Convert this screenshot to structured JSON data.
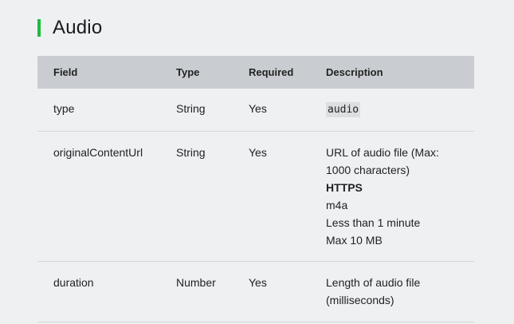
{
  "section": {
    "title": "Audio"
  },
  "table": {
    "headers": {
      "field": "Field",
      "type": "Type",
      "required": "Required",
      "description": "Description"
    },
    "rows": [
      {
        "field": "type",
        "type": "String",
        "required": "Yes",
        "description_code": "audio"
      },
      {
        "field": "originalContentUrl",
        "type": "String",
        "required": "Yes",
        "description_lines": [
          "URL of audio file (Max:",
          "1000 characters)",
          "HTTPS",
          "m4a",
          "Less than 1 minute",
          "Max 10 MB"
        ]
      },
      {
        "field": "duration",
        "type": "Number",
        "required": "Yes",
        "description_lines": [
          "Length of audio file",
          "(milliseconds)"
        ]
      }
    ]
  },
  "colors": {
    "accent": "#1dbd3b",
    "header_bg": "#c9cdd1",
    "page_bg": "#eef0f2"
  }
}
